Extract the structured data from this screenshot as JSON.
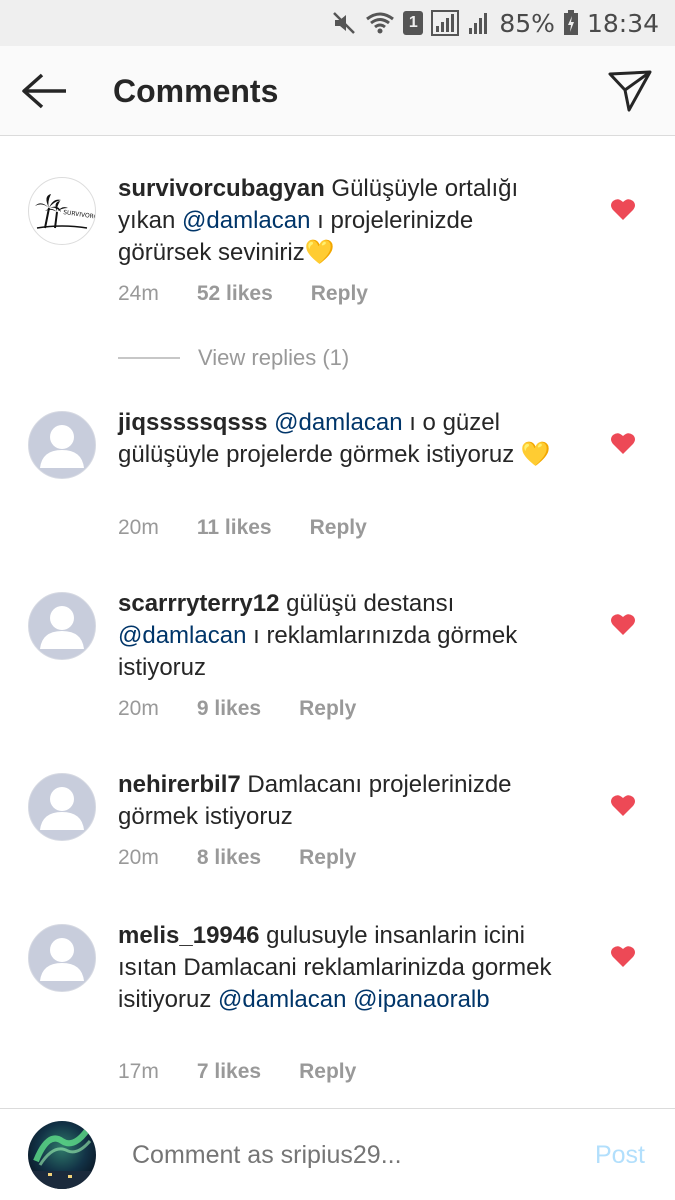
{
  "status_bar": {
    "sim_label": "1",
    "battery": "85%",
    "time": "18:34",
    "icons": [
      "mute-icon",
      "wifi-icon",
      "sim-icon",
      "signal-icon",
      "signal-icon",
      "battery-icon"
    ]
  },
  "header": {
    "title": "Comments",
    "back_icon": "arrow-left-icon",
    "share_icon": "paper-plane-icon"
  },
  "comments": [
    {
      "username": "survivorcubagyan",
      "text_parts": [
        {
          "type": "text",
          "value": " Gülüşüyle ortalığı yıkan "
        },
        {
          "type": "mention",
          "value": "@damlacan"
        },
        {
          "type": "text",
          "value": " ı projelerinizde görürsek seviniriz💛"
        }
      ],
      "time": "24m",
      "likes": "52 likes",
      "reply": "Reply",
      "avatar": "palm-tree-logo",
      "avatar_text": "SURVIVORCU BAGYAN",
      "liked": true
    },
    {
      "username": "jiqsssssqsss",
      "text_parts": [
        {
          "type": "text",
          "value": " "
        },
        {
          "type": "mention",
          "value": "@damlacan"
        },
        {
          "type": "text",
          "value": " ı o güzel gülüşüyle projelerde görmek istiyoruz 💛"
        }
      ],
      "time": "20m",
      "likes": "11 likes",
      "reply": "Reply",
      "avatar": "default-user-icon",
      "liked": true
    },
    {
      "username": "scarrryterry12",
      "text_parts": [
        {
          "type": "text",
          "value": " gülüşü destansı "
        },
        {
          "type": "mention",
          "value": "@damlacan"
        },
        {
          "type": "text",
          "value": " ı reklamlarınızda görmek istiyoruz"
        }
      ],
      "time": "20m",
      "likes": "9 likes",
      "reply": "Reply",
      "avatar": "default-user-icon",
      "liked": true
    },
    {
      "username": "nehirerbil7",
      "text_parts": [
        {
          "type": "text",
          "value": " Damlacanı projelerinizde görmek istiyoruz"
        }
      ],
      "time": "20m",
      "likes": "8 likes",
      "reply": "Reply",
      "avatar": "default-user-icon",
      "liked": true
    },
    {
      "username": "melis_19946",
      "text_parts": [
        {
          "type": "text",
          "value": " gulusuyle insanlarin icini ısıtan Damlacani reklamlarinizda gormek isitiyoruz "
        },
        {
          "type": "mention",
          "value": "@damlacan"
        },
        {
          "type": "text",
          "value": " "
        },
        {
          "type": "mention",
          "value": "@ipanaoralb"
        }
      ],
      "time": "17m",
      "likes": "7 likes",
      "reply": "Reply",
      "avatar": "default-user-icon",
      "liked": true
    }
  ],
  "view_replies": "View replies (1)",
  "composer": {
    "placeholder": "Comment as sripius29...",
    "post_label": "Post",
    "avatar": "aurora-avatar"
  },
  "colors": {
    "heart": "#ed4956",
    "mention": "#003569",
    "meta": "#999999",
    "post_disabled": "#b2dffc"
  }
}
